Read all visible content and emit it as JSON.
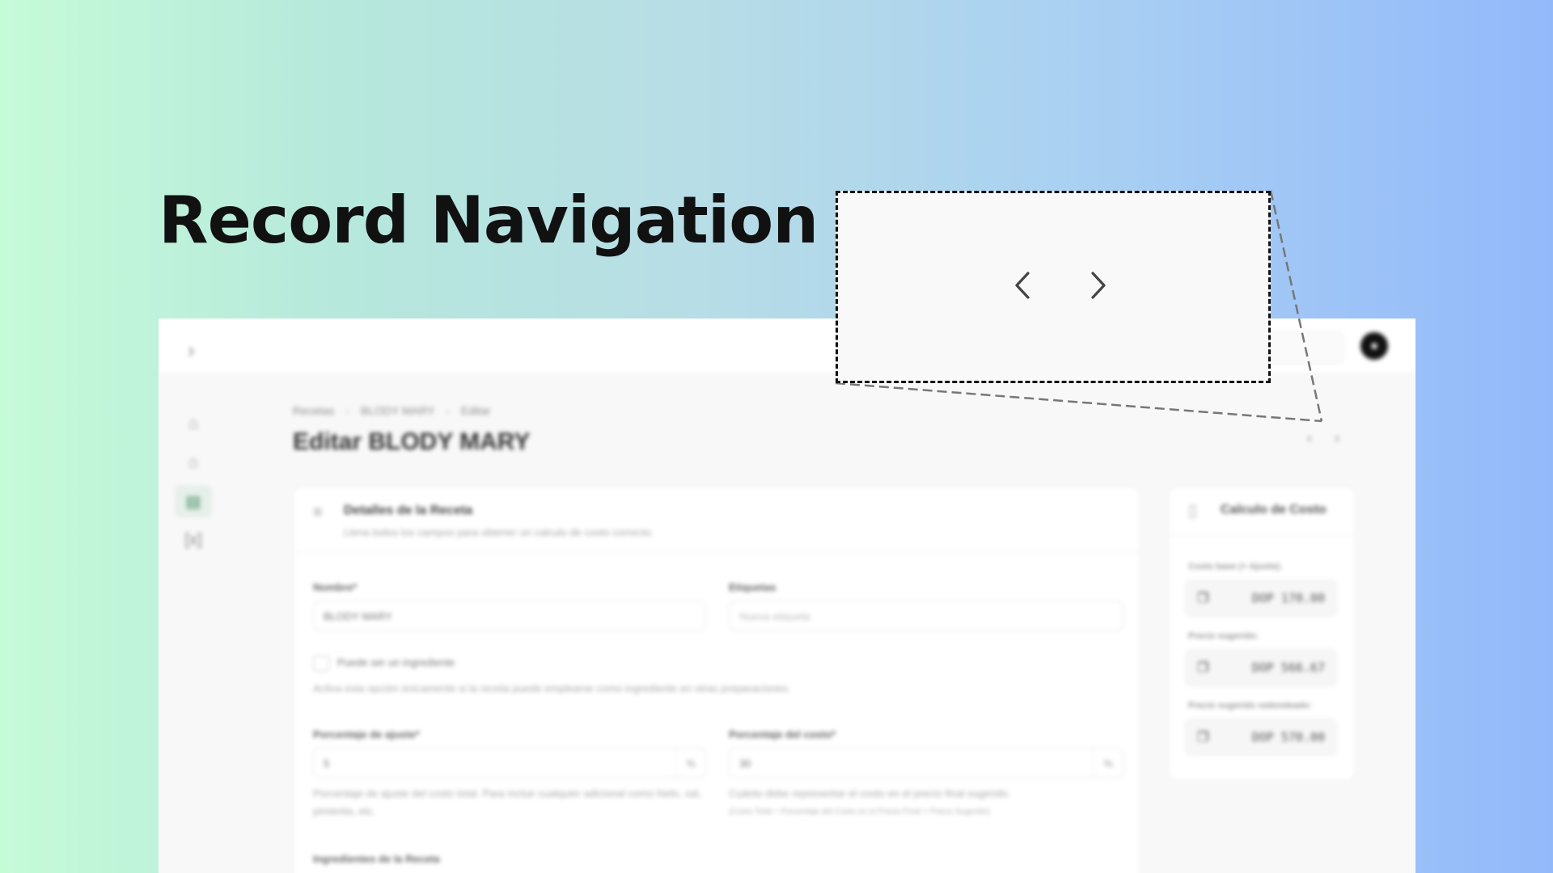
{
  "hero": {
    "title": "Record Navigation"
  },
  "topbar": {
    "avatar_text": "■"
  },
  "breadcrumb": [
    "Recetas",
    "BLODY MARY",
    "Editar"
  ],
  "page_title": "Editar BLODY MARY",
  "details_card": {
    "title": "Detalles de la Receta",
    "subtitle": "Llena todos los campos para obtener un calculo de costo correcto.",
    "name_label": "Nombre*",
    "name_value": "BLODY MARY",
    "tags_label": "Etiquetas",
    "tags_placeholder": "Nueva etiqueta",
    "ingredient_checkbox_label": "Puede ser un ingrediente",
    "ingredient_help": "Activa esta opción únicamente si la receta puede emplearse como ingrediente en otras preparaciones.",
    "adjust_label": "Porcentaje de ajuste*",
    "adjust_value": "5",
    "adjust_suffix": "%",
    "adjust_help": "Porcentaje de ajuste del costo total. Para incluir cualquier adicional como hielo, sal, pimienta, etc.",
    "cost_pct_label": "Porcentaje del costo*",
    "cost_pct_value": "30",
    "cost_pct_suffix": "%",
    "cost_pct_help": "Cuánto debe representar el costo en el precio final sugerido.",
    "cost_pct_formula": "(Costo Total ÷ Porcentaje del Costo en el Precio Final = Precio Sugerido)",
    "ingredients_heading": "Ingredientes de la Receta"
  },
  "cost_card": {
    "title": "Calculo de Costo",
    "items": [
      {
        "label": "Costo base (+ Ajuste):",
        "value": "DOP 170.00"
      },
      {
        "label": "Precio sugerido:",
        "value": "DOP 566.67"
      },
      {
        "label": "Precio sugerido redondeado:",
        "value": "DOP 570.00"
      }
    ]
  },
  "icons": {
    "sidebar": [
      "home-icon",
      "store-icon",
      "table-icon",
      "variable-icon"
    ],
    "pager": [
      "chevron-left-icon",
      "chevron-right-icon"
    ]
  },
  "colors": {
    "accent_green": "#3f8a5c",
    "callout_border": "#111111"
  }
}
